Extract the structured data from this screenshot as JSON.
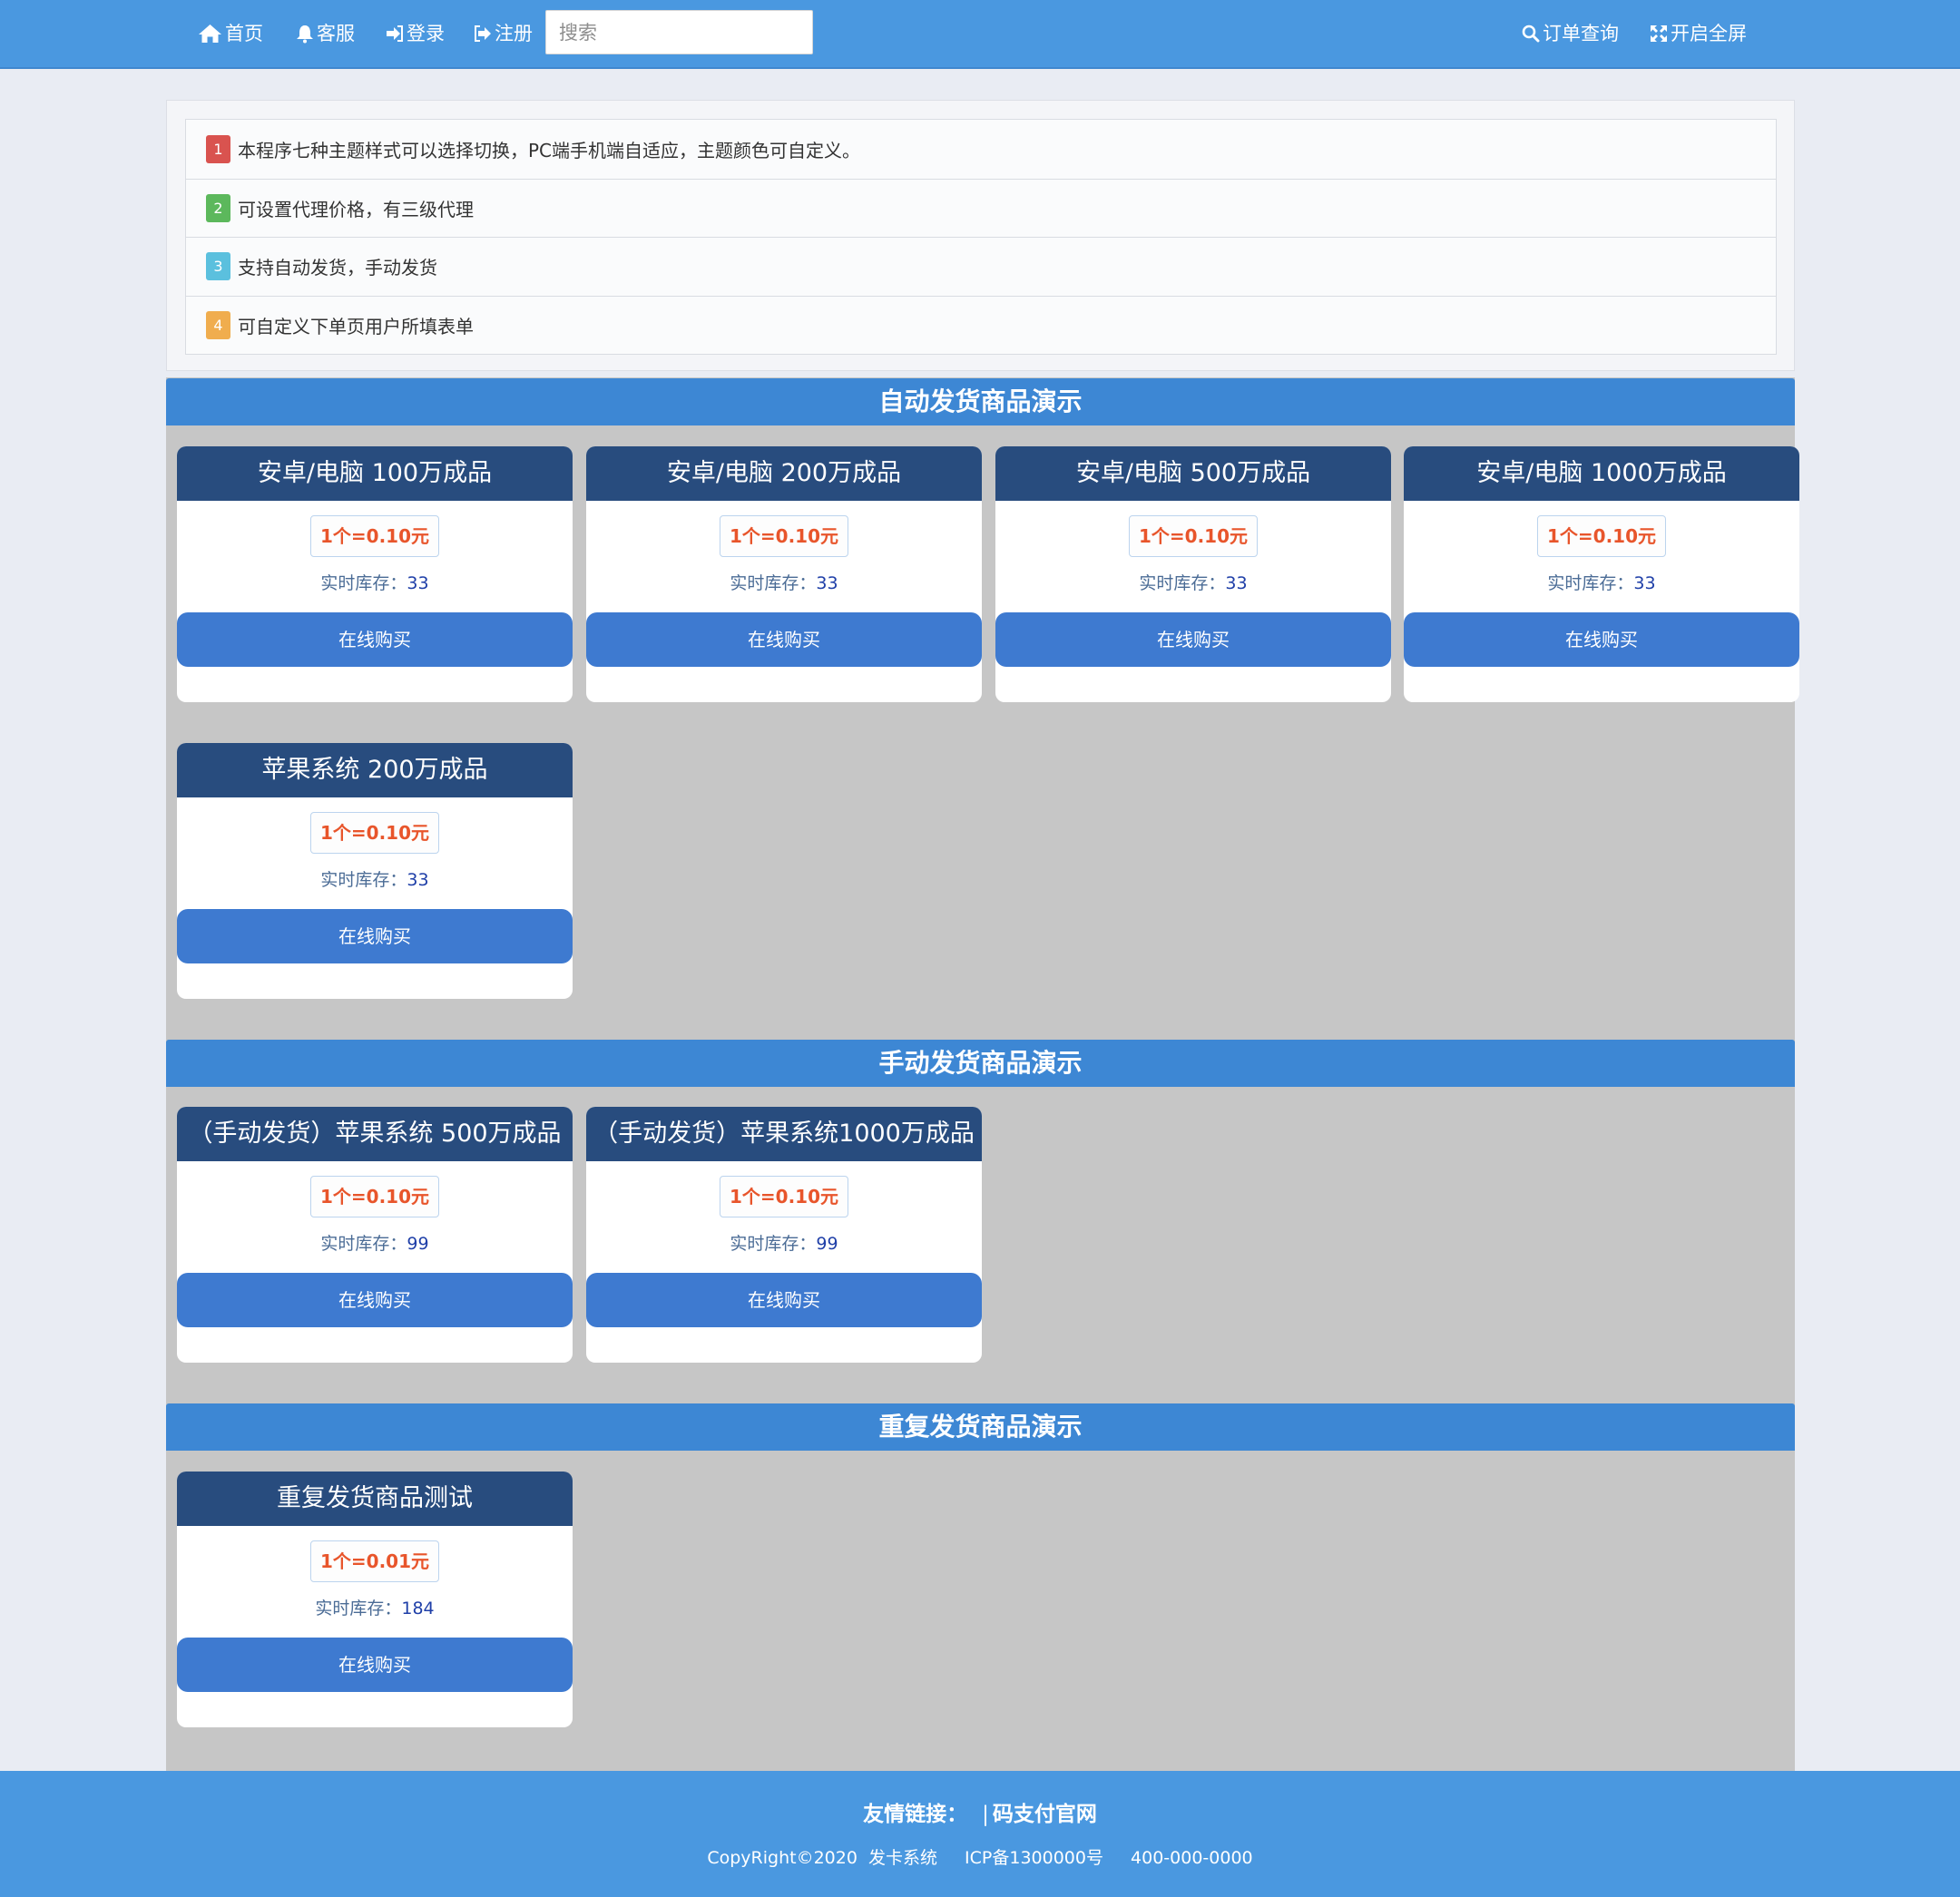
{
  "nav": {
    "home": "首页",
    "service": "客服",
    "login": "登录",
    "register": "注册",
    "search_placeholder": "搜索",
    "order_query": "订单查询",
    "fullscreen": "开启全屏"
  },
  "notices": [
    {
      "num": "1",
      "color": "#d9534f",
      "text": "本程序七种主题样式可以选择切换，PC端手机端自适应，主题颜色可自定义。"
    },
    {
      "num": "2",
      "color": "#5cb85c",
      "text": "可设置代理价格，有三级代理"
    },
    {
      "num": "3",
      "color": "#5bc0de",
      "text": "支持自动发货，手动发货"
    },
    {
      "num": "4",
      "color": "#f0ad4e",
      "text": "可自定义下单页用户所填表单"
    }
  ],
  "sections": [
    {
      "title": "自动发货商品演示",
      "products": [
        {
          "name": "安卓/电脑 100万成品",
          "price": "1个=0.10元",
          "stock_label": "实时库存：",
          "stock": "33",
          "buy": "在线购买"
        },
        {
          "name": "安卓/电脑 200万成品",
          "price": "1个=0.10元",
          "stock_label": "实时库存：",
          "stock": "33",
          "buy": "在线购买"
        },
        {
          "name": "安卓/电脑 500万成品",
          "price": "1个=0.10元",
          "stock_label": "实时库存：",
          "stock": "33",
          "buy": "在线购买"
        },
        {
          "name": "安卓/电脑 1000万成品",
          "price": "1个=0.10元",
          "stock_label": "实时库存：",
          "stock": "33",
          "buy": "在线购买"
        },
        {
          "name": "苹果系统 200万成品",
          "price": "1个=0.10元",
          "stock_label": "实时库存：",
          "stock": "33",
          "buy": "在线购买"
        }
      ]
    },
    {
      "title": "手动发货商品演示",
      "products": [
        {
          "name": "（手动发货）苹果系统 500万成品",
          "price": "1个=0.10元",
          "stock_label": "实时库存：",
          "stock": "99",
          "buy": "在线购买"
        },
        {
          "name": "（手动发货）苹果系统1000万成品",
          "price": "1个=0.10元",
          "stock_label": "实时库存：",
          "stock": "99",
          "buy": "在线购买"
        }
      ]
    },
    {
      "title": "重复发货商品演示",
      "products": [
        {
          "name": "重复发货商品测试",
          "price": "1个=0.01元",
          "stock_label": "实时库存：",
          "stock": "184",
          "buy": "在线购买"
        }
      ]
    }
  ],
  "footer": {
    "links_label": "友情链接：",
    "separator": "|",
    "link": "码支付官网",
    "copyright": "CopyRight©2020 发卡系统",
    "icp": "ICP备1300000号",
    "phone": "400-000-0000"
  }
}
